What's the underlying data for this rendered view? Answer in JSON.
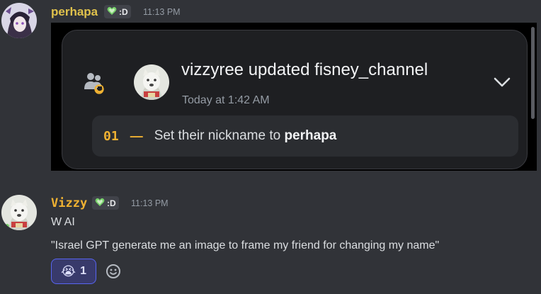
{
  "message1": {
    "username": "perhapa",
    "tag_text": ":D",
    "time": "11:13 PM",
    "name_color": "#e0c24c"
  },
  "audit_log": {
    "title": "vizzyree updated fisney_channel",
    "time": "Today at 1:42 AM",
    "change_number": "01",
    "change_dash": "—",
    "change_prefix": "Set their nickname to ",
    "change_value": "perhapa",
    "icon": "member-update-icon",
    "expand_icon": "chevron-down-icon"
  },
  "message2": {
    "username": "Vizzy",
    "tag_text": ":D",
    "time": "11:13 PM",
    "name_color": "#f0b232",
    "line1": "W AI",
    "line2": "\"Israel GPT generate me an image to frame my friend for changing my name\"",
    "reaction": {
      "emoji": "😭",
      "count": "1"
    },
    "add_reaction_icon": "add-reaction-icon"
  },
  "colors": {
    "background": "#313338",
    "card": "#1e1f22",
    "row": "#2b2d31",
    "accent_blurple": "#5865f2",
    "heart_badge": "#77d26a"
  }
}
